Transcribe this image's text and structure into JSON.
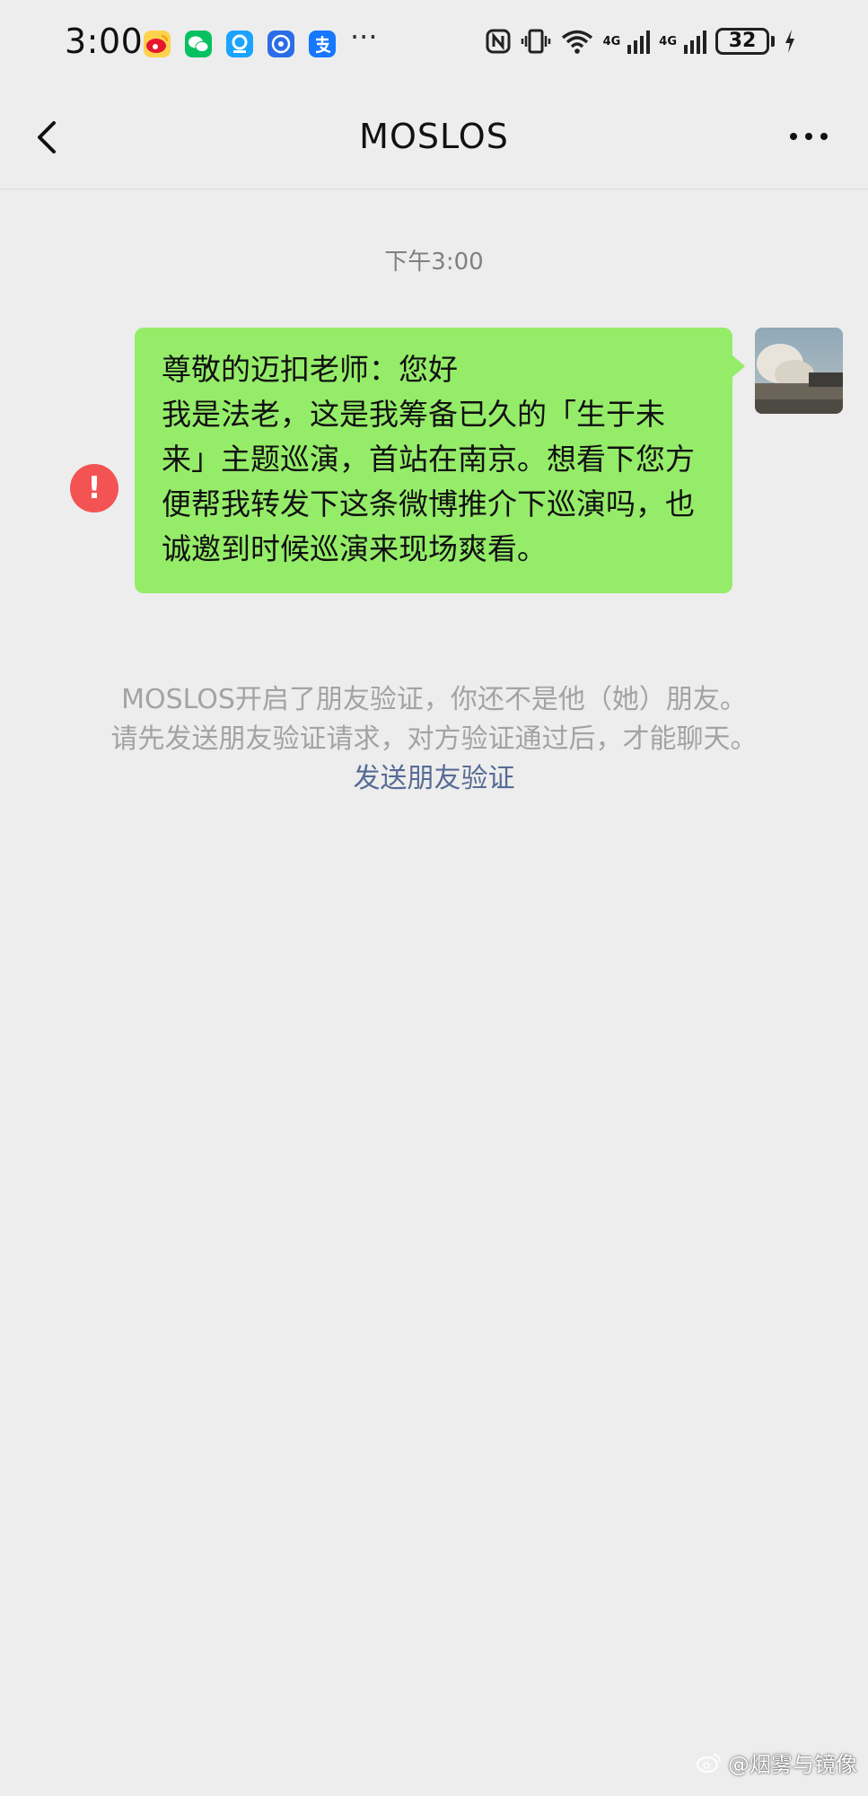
{
  "status_bar": {
    "time": "3:00",
    "network_type": "4G",
    "battery_level": "32",
    "overflow": "···",
    "app_icons": [
      "weibo-icon",
      "wechat-icon",
      "browser-icon",
      "app-icon",
      "alipay-icon"
    ]
  },
  "nav": {
    "title": "MOSLOS"
  },
  "chat": {
    "timestamp": "下午3:00",
    "message": {
      "text": "尊敬的迈扣老师：您好\n我是法老，这是我筹备已久的「生于未来」主题巡演，首站在南京。想看下您方便帮我转发下这条微博推介下巡演吗，也诚邀到时候巡演来现场爽看。",
      "status": "failed"
    },
    "error_mark": "!",
    "system_notice": {
      "line1": "MOSLOS开启了朋友验证，你还不是他（她）朋友。",
      "line2": "请先发送朋友验证请求，对方验证通过后，才能聊天。",
      "link": "发送朋友验证"
    }
  },
  "watermark": "@烟雾与镜像",
  "colors": {
    "bubble": "#95ec69",
    "background": "#ededed",
    "link": "#576b95",
    "error": "#f35353"
  }
}
